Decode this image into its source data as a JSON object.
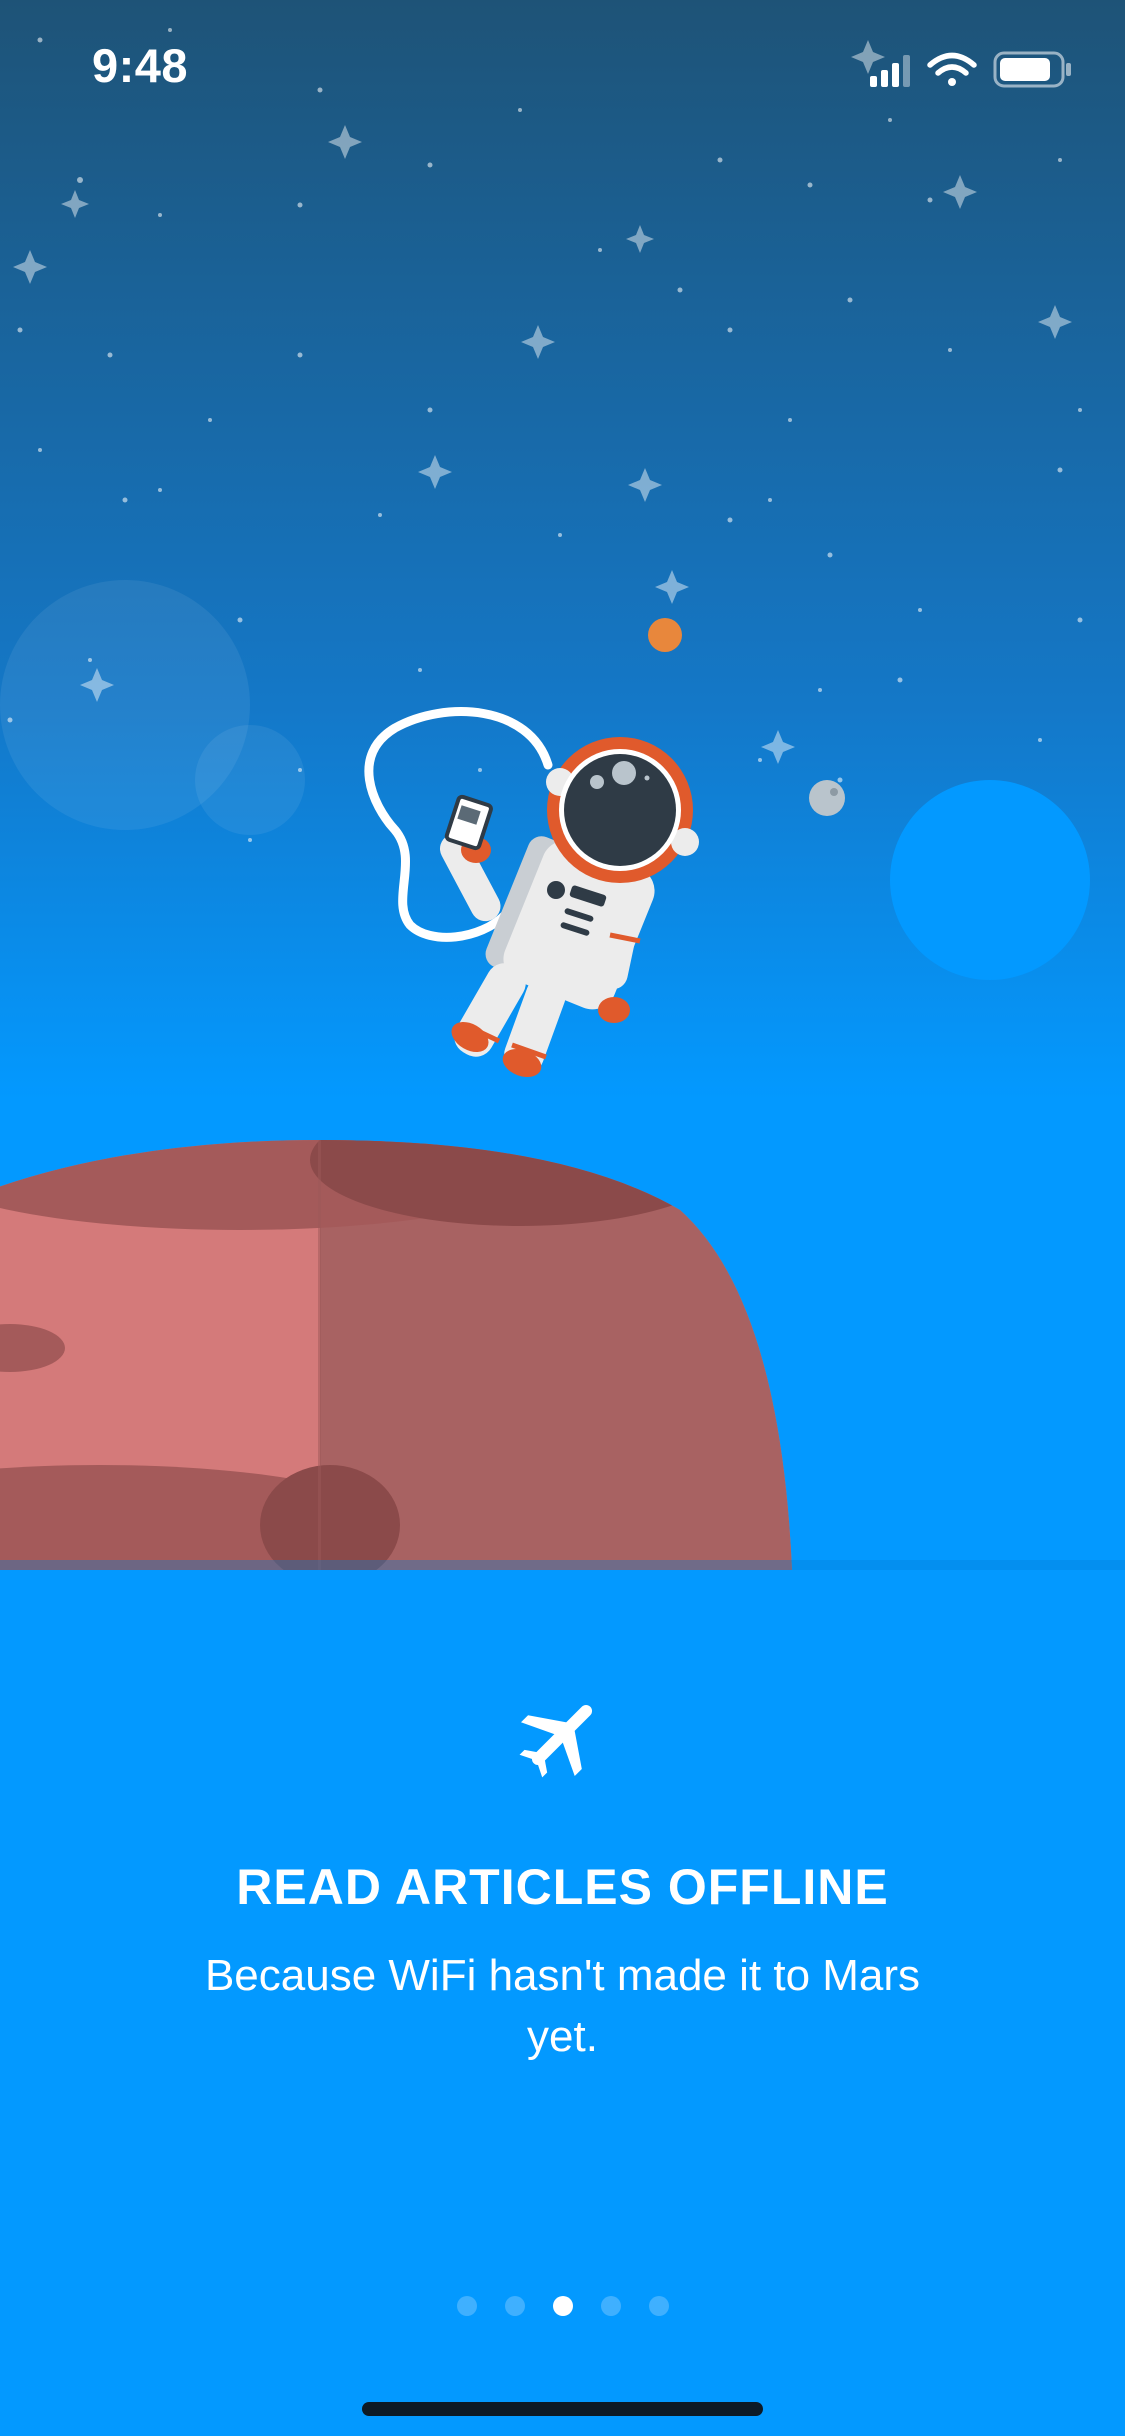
{
  "status_bar": {
    "time": "9:48",
    "icons": [
      "signal-icon",
      "wifi-icon",
      "battery-icon"
    ]
  },
  "illustration": {
    "subject": "astronaut-floating-above-mars"
  },
  "feature": {
    "icon": "airplane-icon",
    "title": "READ ARTICLES OFFLINE",
    "subtitle": "Because WiFi hasn't made it to Mars yet."
  },
  "pager": {
    "total": 5,
    "active_index": 2
  },
  "colors": {
    "sky_top": "#1e5377",
    "sky_bottom": "#0399ff",
    "mars": "#d47a7a",
    "mars_shadow": "#a86262",
    "text": "#ffffff"
  }
}
